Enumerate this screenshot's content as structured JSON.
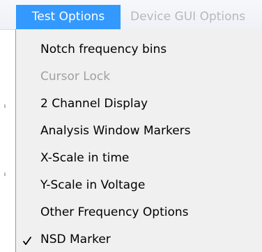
{
  "menubar": {
    "tabs": [
      {
        "label": "Test Options",
        "active": true
      },
      {
        "label": "Device GUI Options",
        "active": false
      }
    ]
  },
  "menu": {
    "items": [
      {
        "label": "Notch frequency bins",
        "enabled": true,
        "checked": false
      },
      {
        "label": "Cursor Lock",
        "enabled": false,
        "checked": false
      },
      {
        "label": "2 Channel Display",
        "enabled": true,
        "checked": false
      },
      {
        "label": "Analysis Window Markers",
        "enabled": true,
        "checked": false
      },
      {
        "label": "X-Scale in time",
        "enabled": true,
        "checked": false
      },
      {
        "label": "Y-Scale in Voltage",
        "enabled": true,
        "checked": false
      },
      {
        "label": "Other Frequency Options",
        "enabled": true,
        "checked": false
      },
      {
        "label": "NSD Marker",
        "enabled": true,
        "checked": true
      }
    ]
  },
  "colors": {
    "highlight": "#3399ff",
    "menu_background": "#f0f0f0",
    "disabled_text": "#a0a0a0",
    "inactive_tab_text": "#b5b8bd"
  }
}
